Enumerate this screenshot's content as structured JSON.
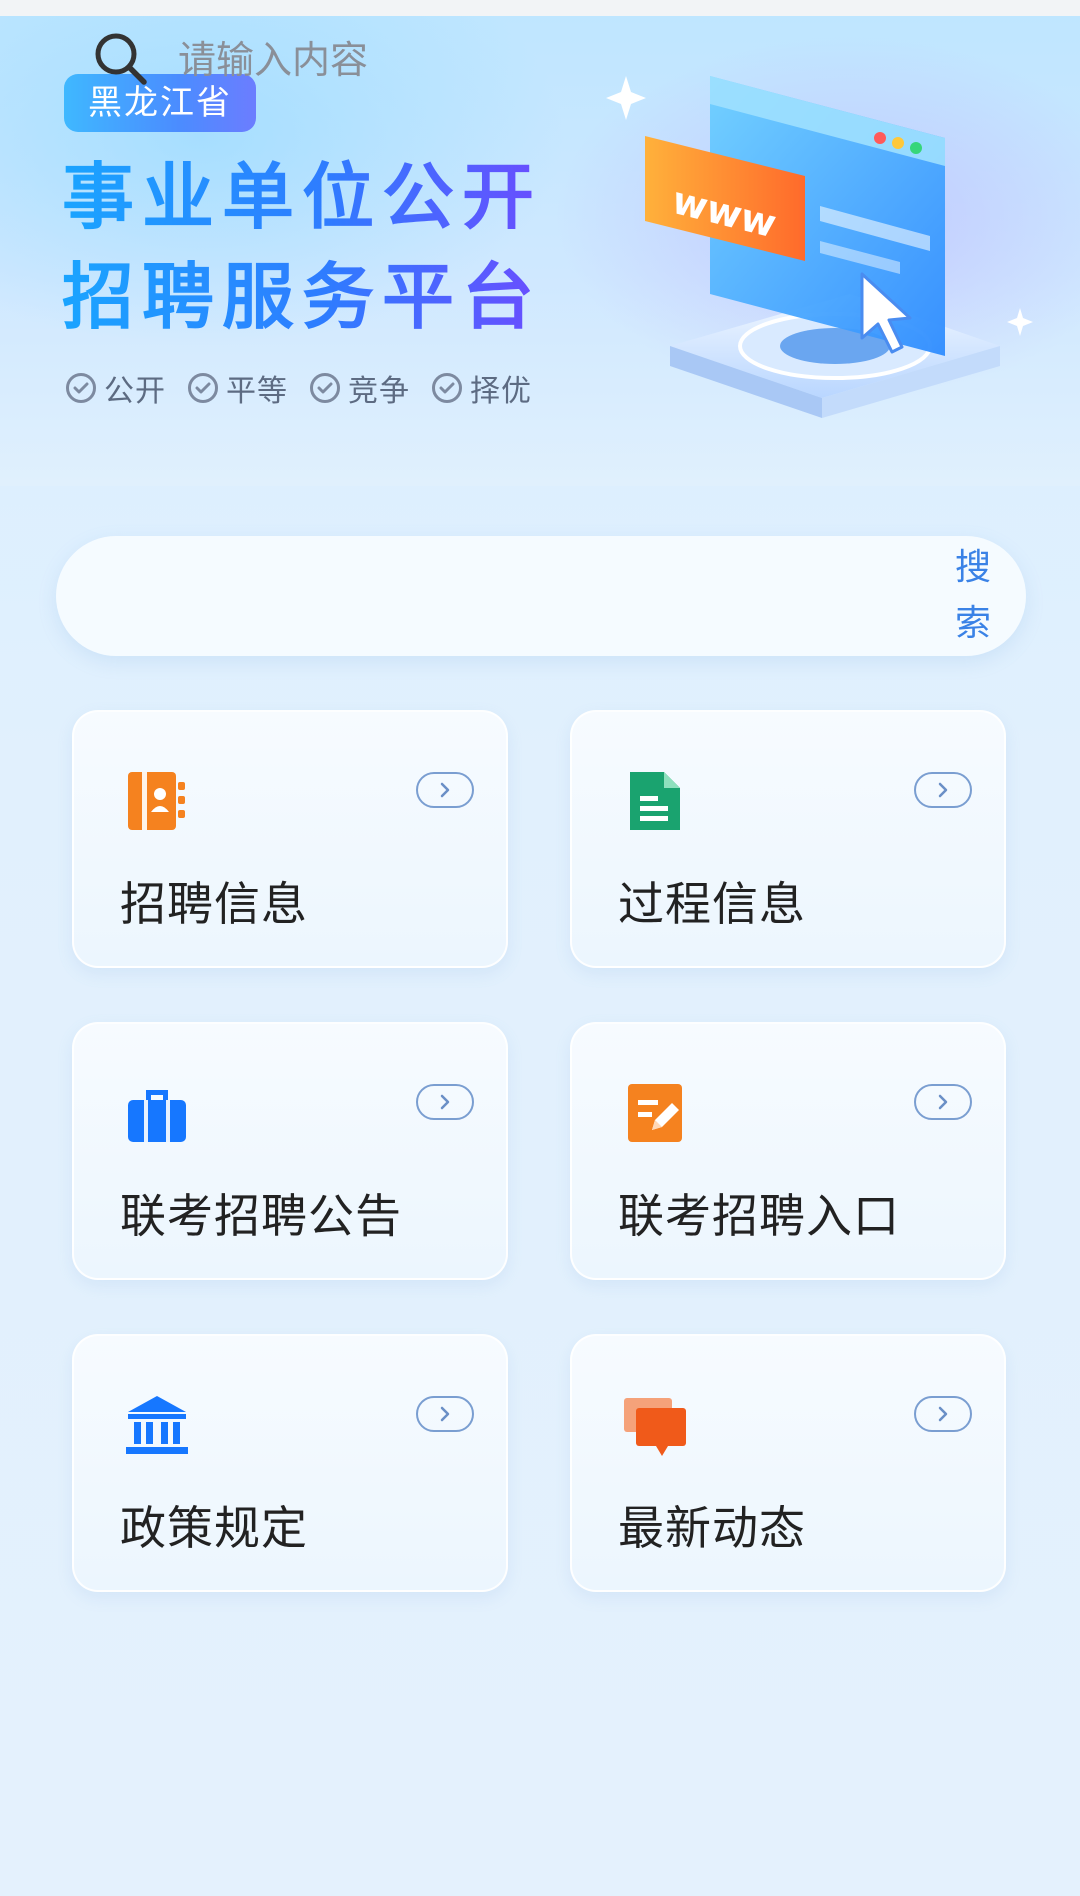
{
  "hero": {
    "region": "黑龙江省",
    "title_line1": "事业单位公开",
    "title_line2": "招聘服务平台",
    "tags": [
      "公开",
      "平等",
      "竞争",
      "择优"
    ],
    "illustration_text": "www"
  },
  "search": {
    "placeholder": "请输入内容",
    "button_line1": "搜",
    "button_line2": "索"
  },
  "menu": [
    {
      "label": "招聘信息",
      "icon": "contact-book-icon",
      "color": "#f5821f"
    },
    {
      "label": "过程信息",
      "icon": "document-icon",
      "color": "#1aa36f"
    },
    {
      "label": "联考招聘公告",
      "icon": "briefcase-icon",
      "color": "#1677ff"
    },
    {
      "label": "联考招聘入口",
      "icon": "edit-form-icon",
      "color": "#f5821f"
    },
    {
      "label": "政策规定",
      "icon": "government-building-icon",
      "color": "#1677ff"
    },
    {
      "label": "最新动态",
      "icon": "chat-bubbles-icon",
      "color": "#f05a1a"
    }
  ]
}
